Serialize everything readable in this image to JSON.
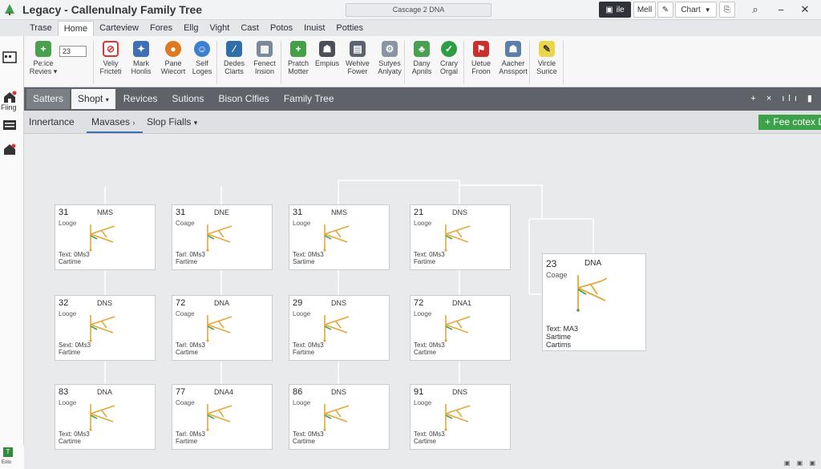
{
  "window": {
    "title": "Legacy - Callenulnaly Family Tree",
    "search": "Cascage 2 DNA",
    "right_buttons": [
      "ile",
      "Mell",
      "Chart"
    ]
  },
  "menu": {
    "tabs": [
      "Trase",
      "Home",
      "Carteview",
      "Fores",
      "Ellg",
      "Vight",
      "Cast",
      "Potos",
      "Inuist",
      "Potties"
    ]
  },
  "ribbon": {
    "input_value": "23",
    "buttons": [
      {
        "l1": "Pe:ice",
        "l2": "Revies"
      },
      {
        "l1": "Veliy",
        "l2": "Fricteti"
      },
      {
        "l1": "Mark",
        "l2": "Honlis"
      },
      {
        "l1": "Pane",
        "l2": "Wiecort"
      },
      {
        "l1": "Self",
        "l2": "Loges"
      },
      {
        "l1": "Dedes",
        "l2": "Clarts"
      },
      {
        "l1": "Fenect",
        "l2": "Insion"
      },
      {
        "l1": "Pratch",
        "l2": "Motter"
      },
      {
        "l1": "Empius",
        "l2": ""
      },
      {
        "l1": "Wehive",
        "l2": "Fower"
      },
      {
        "l1": "Sutyes",
        "l2": "Anlyaty"
      },
      {
        "l1": "Dany",
        "l2": "Apnils"
      },
      {
        "l1": "Crary",
        "l2": "Orgal"
      },
      {
        "l1": "Uetue",
        "l2": "Froon"
      },
      {
        "l1": "Aacher",
        "l2": "Anssport"
      },
      {
        "l1": "Vircle",
        "l2": "Surice"
      }
    ]
  },
  "leftrail": {
    "label": "Fiing"
  },
  "toolbar": {
    "tabs": [
      "Satters",
      "Shopt",
      "Revices",
      "Sutions",
      "Bison Clfies",
      "Family Tree"
    ],
    "controls": "+ × ılı ▮"
  },
  "subbar": {
    "items": [
      "Innertance",
      "Mavases",
      "Slop Fialls"
    ],
    "action_button": "Fee cotex DNA"
  },
  "cards": [
    {
      "num": "31",
      "tag": "NMS",
      "logo": "Looge",
      "t1": "Text: 0Ms3",
      "t2": "Cartime"
    },
    {
      "num": "31",
      "tag": "DNE",
      "logo": "Coage",
      "t1": "Tarl: 0Ms3",
      "t2": "Fartime"
    },
    {
      "num": "31",
      "tag": "NMS",
      "logo": "Looge",
      "t1": "Text: 0Ms3",
      "t2": "Sartime"
    },
    {
      "num": "21",
      "tag": "DNS",
      "logo": "Looge",
      "t1": "Text: 0Ms3",
      "t2": "Fartime"
    },
    {
      "num": "32",
      "tag": "DNS",
      "logo": "Looge",
      "t1": "Sext: 0Ms3",
      "t2": "Fartime"
    },
    {
      "num": "72",
      "tag": "DNA",
      "logo": "Coage",
      "t1": "Tarl: 0Ms3",
      "t2": "Cartime"
    },
    {
      "num": "29",
      "tag": "DNS",
      "logo": "Looge",
      "t1": "Text: 0Ms3",
      "t2": "Fartime"
    },
    {
      "num": "72",
      "tag": "DNA1",
      "logo": "Looge",
      "t1": "Text: 0Ms3",
      "t2": "Cartime"
    },
    {
      "num": "83",
      "tag": "DNA",
      "logo": "Looge",
      "t1": "Text: 0Ms3",
      "t2": "Cartime"
    },
    {
      "num": "77",
      "tag": "DNA4",
      "logo": "Coage",
      "t1": "Tarl: 0Ms3",
      "t2": "Fartime"
    },
    {
      "num": "86",
      "tag": "DNS",
      "logo": "Looge",
      "t1": "Text: 0Ms3",
      "t2": "Cartime"
    },
    {
      "num": "91",
      "tag": "DNS",
      "logo": "Looge",
      "t1": "Text: 0Ms3",
      "t2": "Cartime"
    }
  ],
  "bigcard": {
    "num": "23",
    "tag": "DNA",
    "logo": "Coage",
    "t1": "Text: MA3",
    "t2": "Sartime",
    "t3": "Cartims"
  },
  "status": {
    "badge": "T",
    "text": "Eolo"
  }
}
